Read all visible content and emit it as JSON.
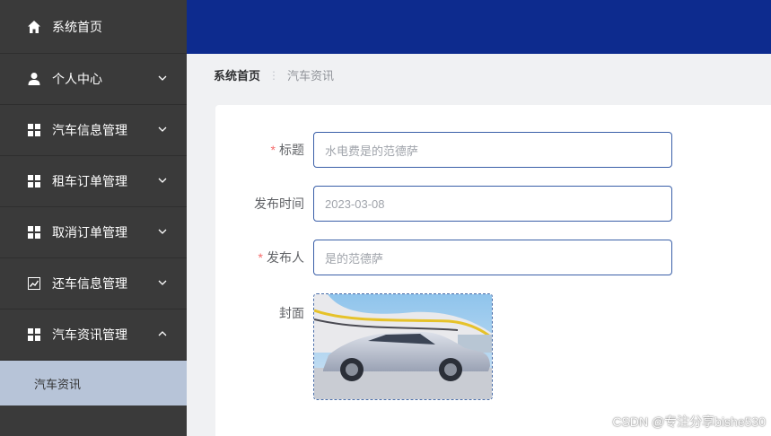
{
  "sidebar": {
    "items": [
      {
        "label": "系统首页",
        "icon": "home-icon"
      },
      {
        "label": "个人中心",
        "icon": "user-icon"
      },
      {
        "label": "汽车信息管理",
        "icon": "grid-icon"
      },
      {
        "label": "租车订单管理",
        "icon": "grid-icon"
      },
      {
        "label": "取消订单管理",
        "icon": "grid-icon"
      },
      {
        "label": "还车信息管理",
        "icon": "chart-icon"
      },
      {
        "label": "汽车资讯管理",
        "icon": "grid-icon",
        "expanded": true
      }
    ],
    "submenu": {
      "label": "汽车资讯"
    }
  },
  "breadcrumb": {
    "home": "系统首页",
    "separator": "⋮",
    "current": "汽车资讯"
  },
  "form": {
    "title": {
      "label": "标题",
      "value": "水电费是的范德萨",
      "required": true
    },
    "publish_time": {
      "label": "发布时间",
      "value": "2023-03-08"
    },
    "publisher": {
      "label": "发布人",
      "value": "是的范德萨",
      "required": true
    },
    "cover": {
      "label": "封面"
    }
  },
  "watermark": "CSDN @专注分享bishe530",
  "colors": {
    "sidebar_bg": "#3a3a3a",
    "topbar_bg": "#0d2b8e",
    "submenu_bg": "#b7c4d8",
    "required": "#f56c6c"
  }
}
